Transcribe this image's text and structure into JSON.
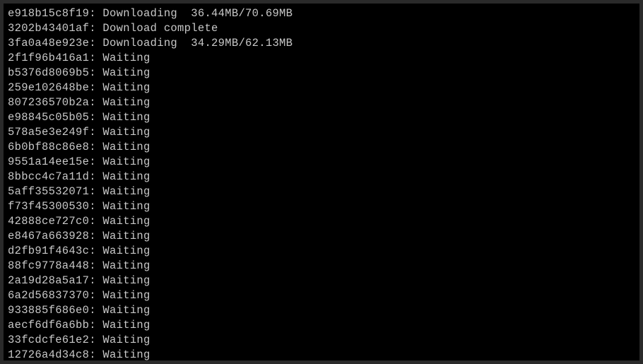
{
  "lines": [
    {
      "hash": "e918b15c8f19",
      "status": "Downloading",
      "progress": "36.44MB/70.69MB"
    },
    {
      "hash": "3202b43401af",
      "status": "Download complete",
      "progress": ""
    },
    {
      "hash": "3fa0a48e923e",
      "status": "Downloading",
      "progress": "34.29MB/62.13MB"
    },
    {
      "hash": "2f1f96b416a1",
      "status": "Waiting",
      "progress": ""
    },
    {
      "hash": "b5376d8069b5",
      "status": "Waiting",
      "progress": ""
    },
    {
      "hash": "259e102648be",
      "status": "Waiting",
      "progress": ""
    },
    {
      "hash": "807236570b2a",
      "status": "Waiting",
      "progress": ""
    },
    {
      "hash": "e98845c05b05",
      "status": "Waiting",
      "progress": ""
    },
    {
      "hash": "578a5e3e249f",
      "status": "Waiting",
      "progress": ""
    },
    {
      "hash": "6b0bf88c86e8",
      "status": "Waiting",
      "progress": ""
    },
    {
      "hash": "9551a14ee15e",
      "status": "Waiting",
      "progress": ""
    },
    {
      "hash": "8bbcc4c7a11d",
      "status": "Waiting",
      "progress": ""
    },
    {
      "hash": "5aff35532071",
      "status": "Waiting",
      "progress": ""
    },
    {
      "hash": "f73f45300530",
      "status": "Waiting",
      "progress": ""
    },
    {
      "hash": "42888ce727c0",
      "status": "Waiting",
      "progress": ""
    },
    {
      "hash": "e8467a663928",
      "status": "Waiting",
      "progress": ""
    },
    {
      "hash": "d2fb91f4643c",
      "status": "Waiting",
      "progress": ""
    },
    {
      "hash": "88fc9778a448",
      "status": "Waiting",
      "progress": ""
    },
    {
      "hash": "2a19d28a5a17",
      "status": "Waiting",
      "progress": ""
    },
    {
      "hash": "6a2d56837370",
      "status": "Waiting",
      "progress": ""
    },
    {
      "hash": "933885f686e0",
      "status": "Waiting",
      "progress": ""
    },
    {
      "hash": "aecf6df6a6bb",
      "status": "Waiting",
      "progress": ""
    },
    {
      "hash": "33fcdcfe61e2",
      "status": "Waiting",
      "progress": ""
    },
    {
      "hash": "12726a4d34c8",
      "status": "Waiting",
      "progress": ""
    }
  ]
}
